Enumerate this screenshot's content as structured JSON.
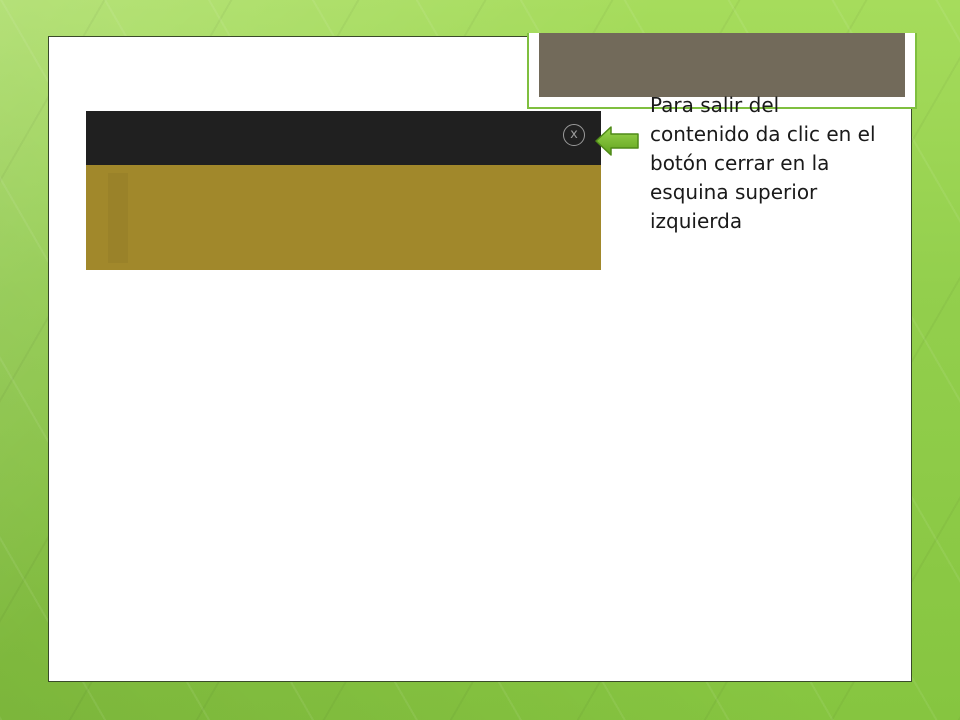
{
  "slide": {
    "close_button": {
      "label": "x",
      "icon": "close-circle-icon"
    },
    "pointer": {
      "icon": "arrow-left-icon",
      "color": "#6ab023"
    },
    "caption": "Para salir del contenido da clic en el botón cerrar en la esquina superior izquierda"
  },
  "colors": {
    "background": "#8fd14a",
    "panel": "#ffffff",
    "header_block": "#726a5a",
    "header_border": "#7fbf3f",
    "video_bar": "#202020",
    "video_body": "#a1882b"
  }
}
